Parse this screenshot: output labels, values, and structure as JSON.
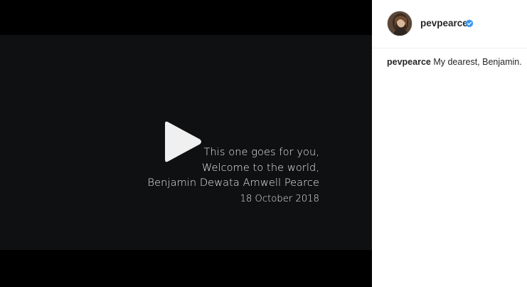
{
  "video": {
    "caption_lines": [
      "This one goes for you,",
      "Welcome to the world,",
      "Benjamin Dewata Amwell Pearce"
    ],
    "date": "18 October 2018",
    "play_icon": "play-icon"
  },
  "post": {
    "username": "pevpearce",
    "verified_icon": "verified-badge-icon",
    "avatar_icon": "avatar",
    "comment": {
      "author": "pevpearce",
      "text": "My dearest, Benjamin."
    }
  },
  "colors": {
    "video_background": "#0f1011",
    "letterbox": "#000000",
    "caption_text": "#e9e9e9",
    "verified_blue": "#3897f0",
    "text": "#262626"
  }
}
